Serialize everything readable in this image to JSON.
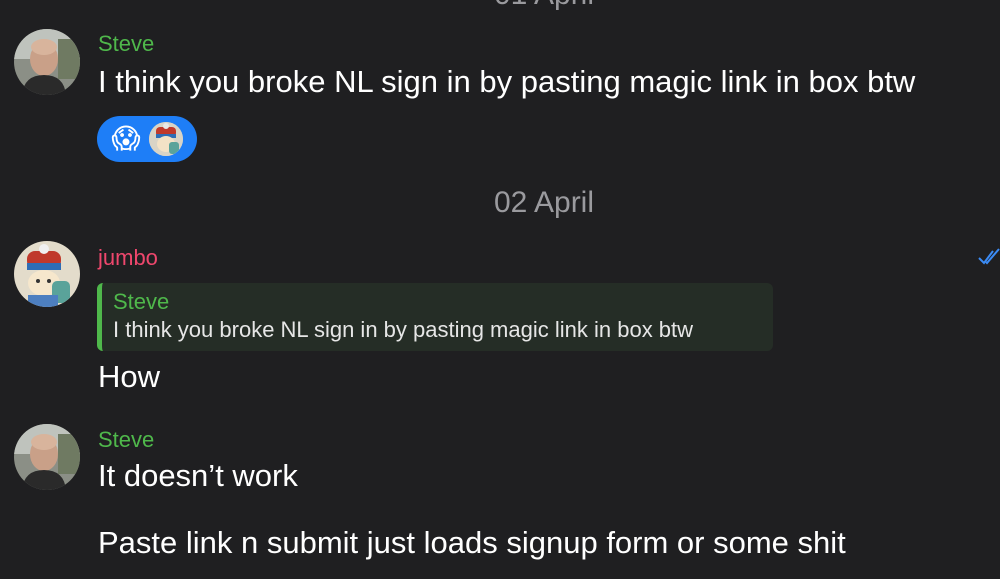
{
  "date_separators": {
    "top": "01 April",
    "middle": "02 April"
  },
  "messages": [
    {
      "sender": "Steve",
      "text": "I think you broke NL sign in by pasting magic link in box btw",
      "reactions": {
        "emoji": "😱",
        "avatar": "jumbo-avatar"
      }
    },
    {
      "sender": "jumbo",
      "reply_to": {
        "sender": "Steve",
        "text": "I think you broke NL sign in by pasting magic link in box btw"
      },
      "text": "How",
      "status": "read-check-icon"
    },
    {
      "sender": "Steve",
      "text": "It doesn’t work",
      "text2": "Paste link n submit just loads signup form or some shit"
    }
  ],
  "colors": {
    "background": "#1f1f21",
    "steve_name": "#4fb84b",
    "jumbo_name": "#ef476d",
    "reaction_bubble": "#1e7ef7",
    "quote_bg": "#252d26",
    "date_text": "#9a9a9e"
  }
}
